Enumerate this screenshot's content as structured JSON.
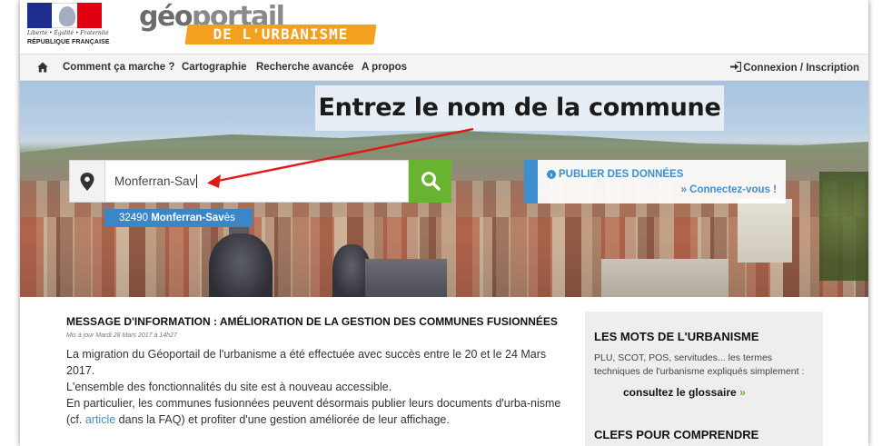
{
  "header": {
    "rf_motto": "Liberté • Égalité • Fraternité",
    "rf_name": "RÉPUBLIQUE FRANÇAISE",
    "logo_part1": "géo",
    "logo_part2": "portail",
    "logo_subtitle": "DE L'URBANISME"
  },
  "nav": {
    "home_icon": "home-icon",
    "items": [
      "Comment ça marche ?",
      "Cartographie",
      "Recherche avancée",
      "A propos"
    ],
    "login": "Connexion / Inscription"
  },
  "hero": {
    "title": "Entrez le nom de la commune",
    "search": {
      "value": "Monferran-Sav",
      "icon": "map-marker-icon"
    },
    "suggestion": {
      "code": "32490",
      "name_bold": "Monferran-Sav",
      "name_rest": "ès"
    },
    "publish": {
      "line1": "PUBLIER DES DONNÉES",
      "line2": "» Connectez-vous !"
    }
  },
  "article": {
    "title": "MESSAGE D'INFORMATION : AMÉLIORATION DE LA GESTION DES COMMUNES FUSIONNÉES",
    "date": "Mis à jour Mardi 28 Mars 2017 à 14h27",
    "p1": "La migration du Géoportail de l'urbanisme a été effectuée avec succès entre le 20 et le 24 Mars 2017.",
    "p2": "L'ensemble des fonctionnalités du site est à nouveau accessible.",
    "p3_start": "En particulier, les communes fusionnées peuvent désormais publier leurs documents d'urba-nisme (cf. ",
    "p3_link": "article",
    "p3_end": " dans la FAQ) et profiter d'une gestion améliorée de leur affichage."
  },
  "sidebar": {
    "title1": "LES MOTS DE L'URBANISME",
    "desc": "PLU, SCOT, POS, servitudes... les termes techniques de l'urbanisme expliqués simplement :",
    "glossary": "consultez le glossaire",
    "glossary_chevron": "»",
    "title2": "CLEFS POUR COMPRENDRE"
  },
  "colors": {
    "accent_blue": "#3d8fd0",
    "search_green": "#6ab330",
    "logo_orange": "#f2a01e",
    "annotation_red": "#e01818"
  }
}
